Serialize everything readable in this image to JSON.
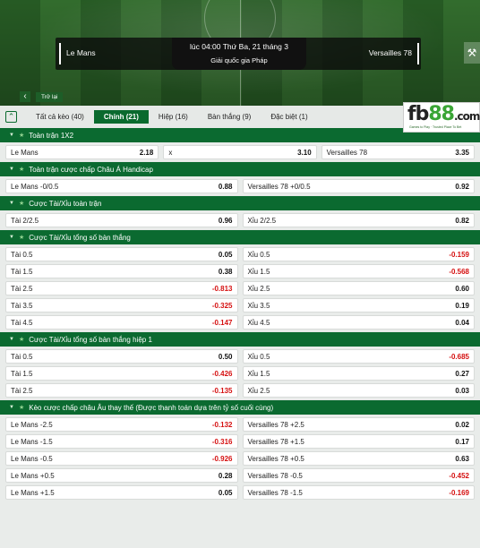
{
  "match": {
    "home_team": "Le Mans",
    "away_team": "Versailles 78",
    "time": "lúc 04:00 Thứ Ba, 21 tháng 3",
    "league": "Giải quốc gia Pháp",
    "back_label": "Trở lại"
  },
  "tabs": [
    {
      "label": "Tất cả kèo (40)",
      "active": false
    },
    {
      "label": "Chính (21)",
      "active": true
    },
    {
      "label": "Hiệp (16)",
      "active": false
    },
    {
      "label": "Bàn thắng (9)",
      "active": false
    },
    {
      "label": "Đặc biệt (1)",
      "active": false
    }
  ],
  "logo": {
    "text_a": "fb",
    "text_b": "88",
    "text_c": ".com",
    "tagline": "Games to Play · Trusted Place To Bet"
  },
  "sections": [
    {
      "title": "Toàn trận 1X2",
      "three_way": true,
      "rows": [
        [
          {
            "label": "Le Mans",
            "odd": "2.18"
          },
          {
            "label": "x",
            "odd": "3.10"
          },
          {
            "label": "Versailles 78",
            "odd": "3.35"
          }
        ]
      ]
    },
    {
      "title": "Toàn trận cược chấp Châu Á Handicap",
      "rows": [
        [
          {
            "label": "Le Mans -0/0.5",
            "odd": "0.88"
          },
          {
            "label": "Versailles 78 +0/0.5",
            "odd": "0.92"
          }
        ]
      ]
    },
    {
      "title": "Cược Tài/Xỉu toàn trận",
      "rows": [
        [
          {
            "label": "Tài 2/2.5",
            "odd": "0.96"
          },
          {
            "label": "Xỉu 2/2.5",
            "odd": "0.82"
          }
        ]
      ]
    },
    {
      "title": "Cược Tài/Xỉu tổng số bàn thắng",
      "rows": [
        [
          {
            "label": "Tài 0.5",
            "odd": "0.05"
          },
          {
            "label": "Xỉu 0.5",
            "odd": "-0.159"
          }
        ],
        [
          {
            "label": "Tài 1.5",
            "odd": "0.38"
          },
          {
            "label": "Xỉu 1.5",
            "odd": "-0.568"
          }
        ],
        [
          {
            "label": "Tài 2.5",
            "odd": "-0.813"
          },
          {
            "label": "Xỉu 2.5",
            "odd": "0.60"
          }
        ],
        [
          {
            "label": "Tài 3.5",
            "odd": "-0.325"
          },
          {
            "label": "Xỉu 3.5",
            "odd": "0.19"
          }
        ],
        [
          {
            "label": "Tài 4.5",
            "odd": "-0.147"
          },
          {
            "label": "Xỉu 4.5",
            "odd": "0.04"
          }
        ]
      ]
    },
    {
      "title": "Cược Tài/Xỉu tổng số bàn thắng hiệp 1",
      "rows": [
        [
          {
            "label": "Tài 0.5",
            "odd": "0.50"
          },
          {
            "label": "Xỉu 0.5",
            "odd": "-0.685"
          }
        ],
        [
          {
            "label": "Tài 1.5",
            "odd": "-0.426"
          },
          {
            "label": "Xỉu 1.5",
            "odd": "0.27"
          }
        ],
        [
          {
            "label": "Tài 2.5",
            "odd": "-0.135"
          },
          {
            "label": "Xỉu 2.5",
            "odd": "0.03"
          }
        ]
      ]
    },
    {
      "title": "Kèo cược chấp châu Âu thay thế (Được thanh toán dựa trên tỷ số cuối cùng)",
      "rows": [
        [
          {
            "label": "Le Mans -2.5",
            "odd": "-0.132"
          },
          {
            "label": "Versailles 78 +2.5",
            "odd": "0.02"
          }
        ],
        [
          {
            "label": "Le Mans -1.5",
            "odd": "-0.316"
          },
          {
            "label": "Versailles 78 +1.5",
            "odd": "0.17"
          }
        ],
        [
          {
            "label": "Le Mans -0.5",
            "odd": "-0.926"
          },
          {
            "label": "Versailles 78 +0.5",
            "odd": "0.63"
          }
        ],
        [
          {
            "label": "Le Mans +0.5",
            "odd": "0.28"
          },
          {
            "label": "Versailles 78 -0.5",
            "odd": "-0.452"
          }
        ],
        [
          {
            "label": "Le Mans +1.5",
            "odd": "0.05"
          },
          {
            "label": "Versailles 78 -1.5",
            "odd": "-0.169"
          }
        ]
      ]
    }
  ],
  "colors": {
    "brand_green": "#0b6a30",
    "negative": "#d51010"
  }
}
